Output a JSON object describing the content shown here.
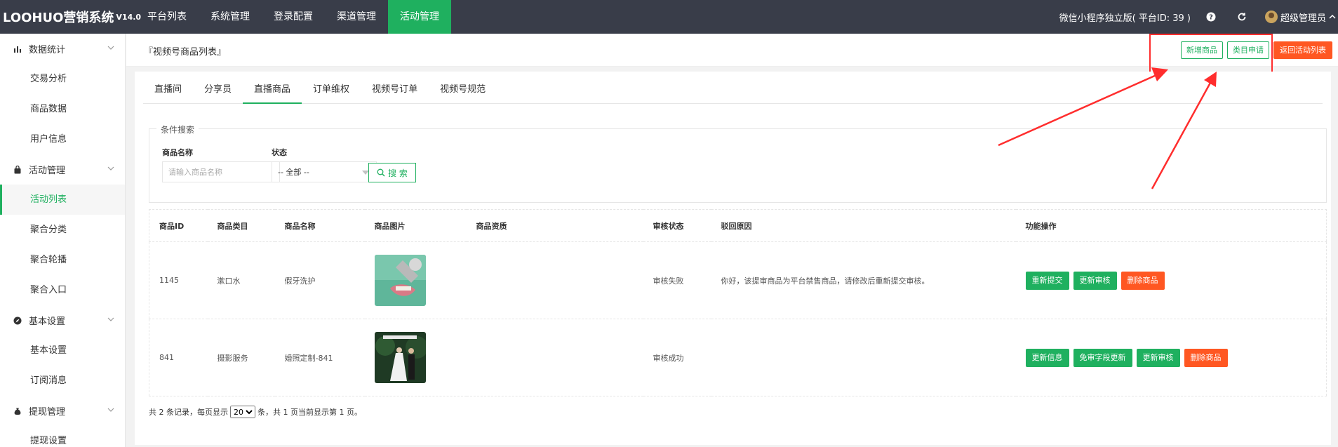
{
  "header": {
    "logo": "LOOHUO营销系统",
    "version": "V14.0",
    "nav": [
      "平台列表",
      "系统管理",
      "登录配置",
      "渠道管理",
      "活动管理"
    ],
    "active_nav": "活动管理",
    "platform_info": "微信小程序独立版( 平台ID: 39 )",
    "admin_name": "超级管理员"
  },
  "sidebar": {
    "groups": [
      {
        "label": "数据统计",
        "icon": "bar-chart-icon",
        "items": [
          "交易分析",
          "商品数据",
          "用户信息"
        ]
      },
      {
        "label": "活动管理",
        "icon": "bag-icon",
        "items": [
          "活动列表",
          "聚合分类",
          "聚合轮播",
          "聚合入口"
        ]
      },
      {
        "label": "基本设置",
        "icon": "compass-icon",
        "items": [
          "基本设置",
          "订阅消息"
        ]
      },
      {
        "label": "提现管理",
        "icon": "money-bag-icon",
        "items": [
          "提现设置"
        ]
      }
    ],
    "active_item": "活动列表"
  },
  "page": {
    "title": "『视频号商品列表』",
    "buttons": {
      "add_product": "新增商品",
      "category_apply": "类目申请",
      "back": "返回活动列表"
    }
  },
  "tabs": [
    "直播间",
    "分享员",
    "直播商品",
    "订单维权",
    "视频号订单",
    "视频号规范"
  ],
  "active_tab": "直播商品",
  "search": {
    "legend": "条件搜索",
    "name_label": "商品名称",
    "name_placeholder": "请输入商品名称",
    "status_label": "状态",
    "status_value": "-- 全部 --",
    "search_button": "搜 索"
  },
  "table": {
    "columns": [
      "商品ID",
      "商品类目",
      "商品名称",
      "商品图片",
      "商品资质",
      "审核状态",
      "驳回原因",
      "功能操作"
    ],
    "rows": [
      {
        "id": "1145",
        "category": "漱口水",
        "name": "假牙洗护",
        "qualification": "",
        "status": "审核失败",
        "reason": "你好，该提审商品为平台禁售商品，请修改后重新提交审核。",
        "image_icon": "dental-photo-icon",
        "actions": [
          {
            "label": "重新提交",
            "color": "#1fb05f"
          },
          {
            "label": "更新审核",
            "color": "#1fb05f"
          },
          {
            "label": "删除商品",
            "color": "#ff5722"
          }
        ]
      },
      {
        "id": "841",
        "category": "摄影服务",
        "name": "婚照定制-841",
        "qualification": "",
        "status": "审核成功",
        "reason": "",
        "image_icon": "wedding-photo-icon",
        "actions": [
          {
            "label": "更新信息",
            "color": "#1fb05f"
          },
          {
            "label": "免审字段更新",
            "color": "#1fb05f"
          },
          {
            "label": "更新审核",
            "color": "#1fb05f"
          },
          {
            "label": "删除商品",
            "color": "#ff5722"
          }
        ]
      }
    ]
  },
  "pager": {
    "prefix": "共 2 条记录，每页显示",
    "page_size": "20",
    "suffix": "条，共 1 页当前显示第 1 页。"
  },
  "colors": {
    "accent": "#1fb05f",
    "danger": "#ff5722",
    "topbar": "#393d49",
    "annotation": "#ff2d2d"
  }
}
